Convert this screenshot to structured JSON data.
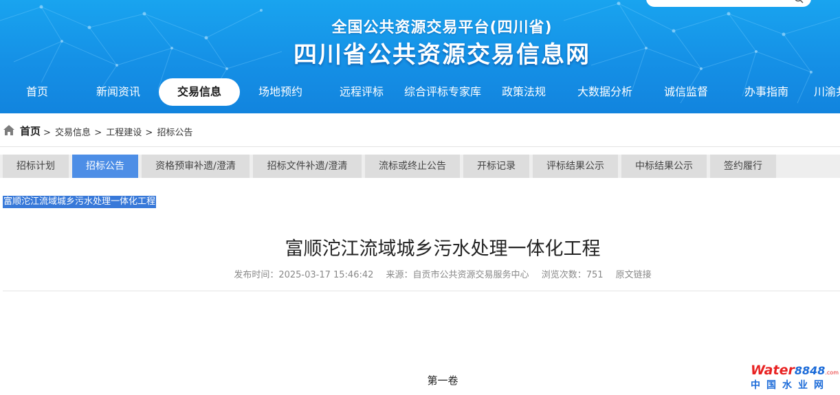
{
  "header": {
    "subtitle": "全国公共资源交易平台(四川省)",
    "title": "四川省公共资源交易信息网"
  },
  "nav": {
    "items": [
      "首页",
      "新闻资讯",
      "交易信息",
      "场地预约",
      "远程评标",
      "综合评标专家库",
      "政策法规",
      "大数据分析",
      "诚信监督",
      "办事指南",
      "川渝共"
    ],
    "active_index": 2
  },
  "breadcrumb": {
    "home": "首页",
    "items": [
      "交易信息",
      "工程建设",
      "招标公告"
    ],
    "separator": ">"
  },
  "tabs": {
    "items": [
      "招标计划",
      "招标公告",
      "资格预审补遗/澄清",
      "招标文件补遗/澄清",
      "流标或终止公告",
      "开标记录",
      "评标结果公示",
      "中标结果公示",
      "签约履行"
    ],
    "active_index": 1
  },
  "selected_text": "富顺沱江流域城乡污水处理一体化工程",
  "article": {
    "title": "富顺沱江流域城乡污水处理一体化工程",
    "publish_time": "发布时间：2025-03-17 15:46:42",
    "source": "来源：自贡市公共资源交易服务中心",
    "views": "浏览次数：751",
    "original_link": "原文链接",
    "volume": "第一卷"
  },
  "watermark": {
    "brand_word": "Water",
    "brand_num": "8848",
    "brand_suffix": ".com",
    "brand_cn": "中国水业网"
  },
  "colors": {
    "header_blue": "#1590e6",
    "tab_active": "#4d8ee6",
    "selection": "#3879d9",
    "watermark_red": "#e82222",
    "watermark_blue": "#1a6ad8"
  }
}
